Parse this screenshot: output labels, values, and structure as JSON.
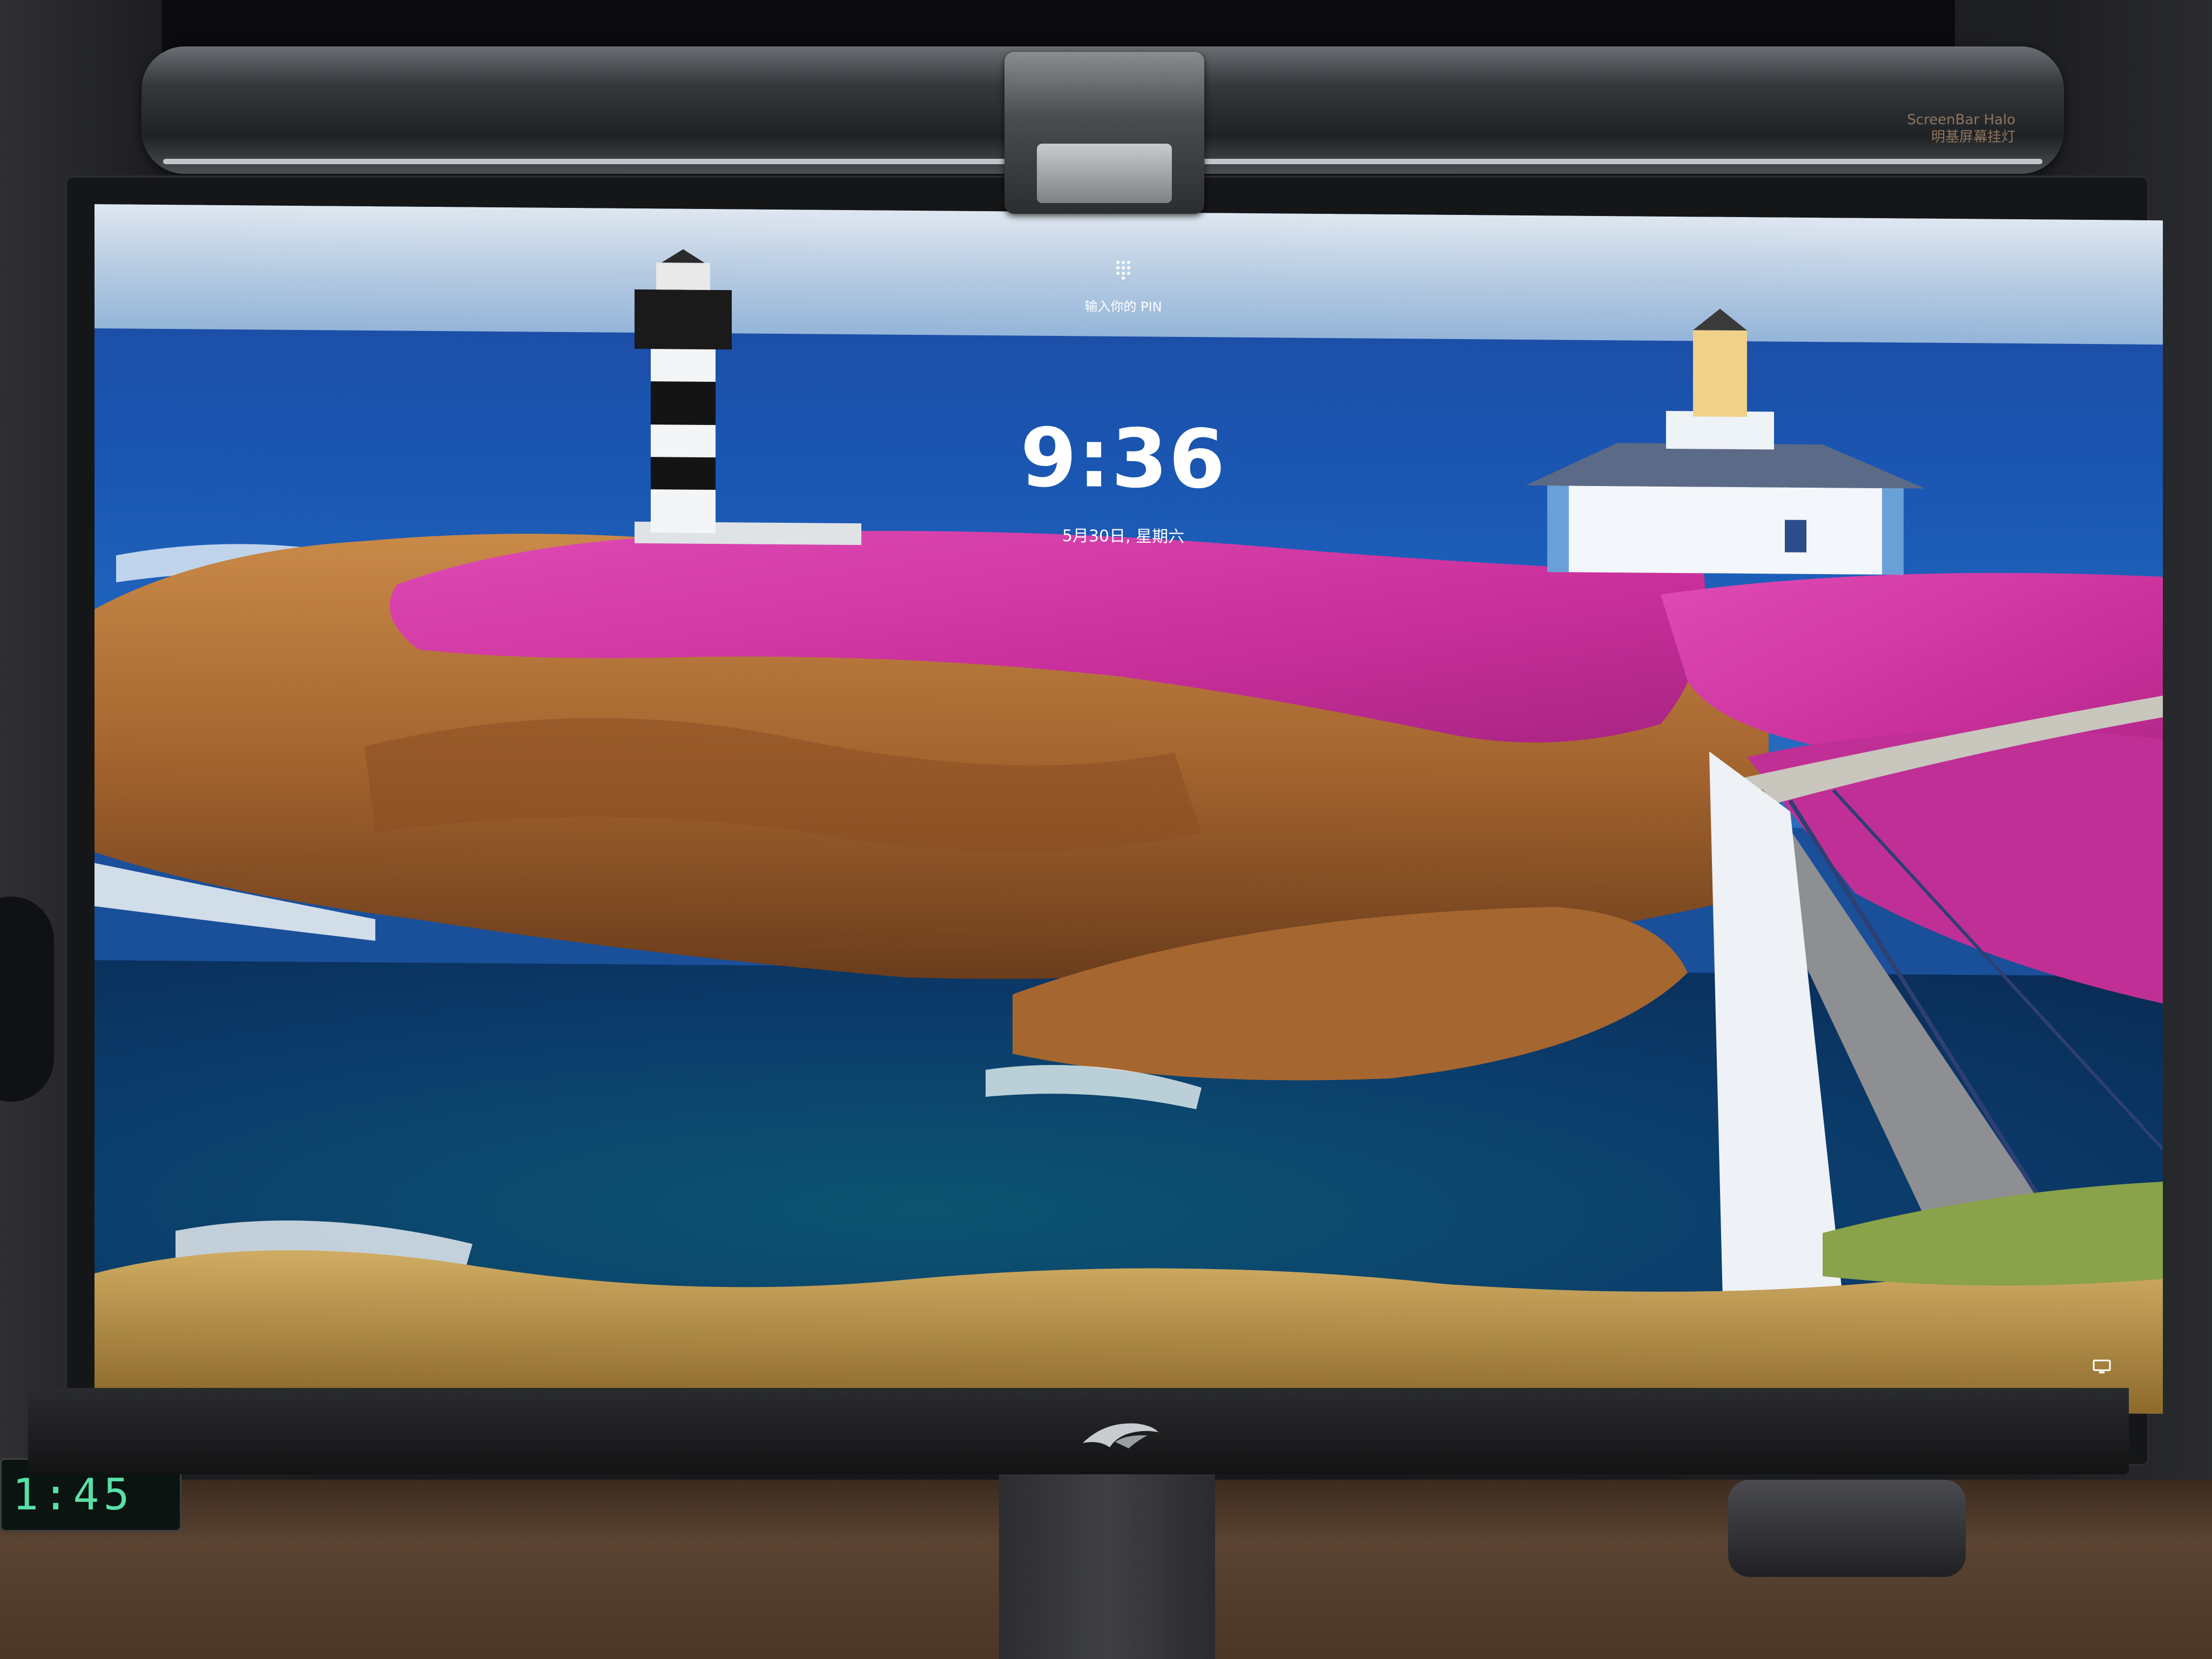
{
  "lock_screen": {
    "pin_prompt": "输入你的 PIN",
    "time": "9:36",
    "date": "5月30日, 星期六"
  },
  "light_bar": {
    "brand_line1": "ScreenBar Halo",
    "brand_line2": "明基屏幕挂灯"
  },
  "desk_clock": {
    "display": "1:45"
  },
  "colors": {
    "flowers": "#d43aa6",
    "sea": "#1c58b0",
    "rocks": "#b7793f"
  },
  "icons": [
    "keypad-icon",
    "network-icon",
    "rog-logo-icon"
  ]
}
